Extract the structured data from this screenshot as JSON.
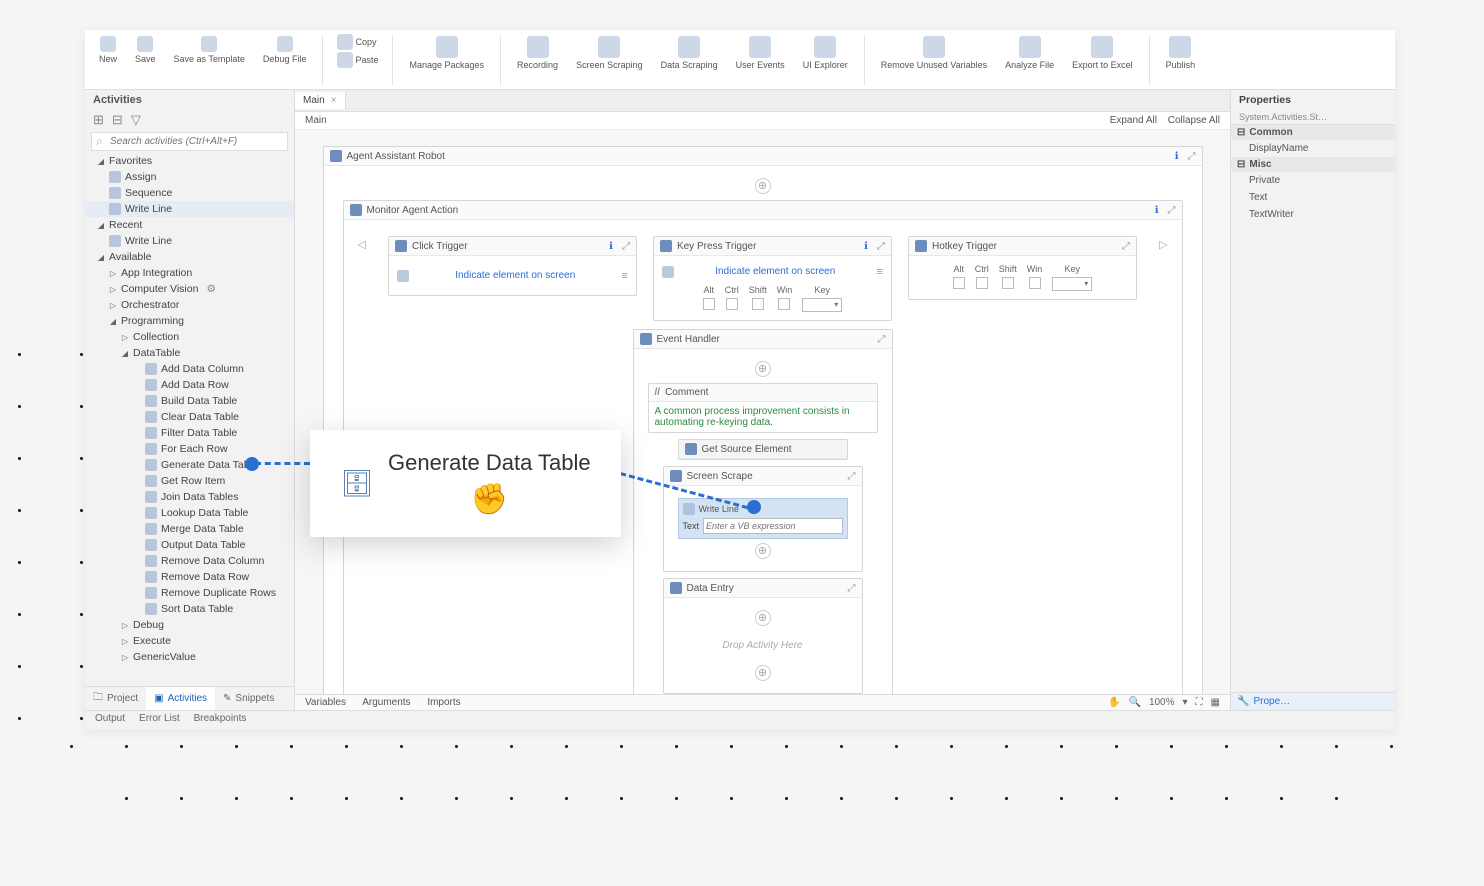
{
  "ribbon": {
    "items": [
      "New",
      "Save",
      "Save as Template",
      "Debug File",
      "Copy",
      "Paste",
      "Manage Packages",
      "Recording",
      "Screen Scraping",
      "Data Scraping",
      "User Events",
      "UI Explorer",
      "Remove Unused Variables",
      "Analyze File",
      "Export to Excel",
      "Publish"
    ]
  },
  "activities_panel": {
    "title": "Activities",
    "search_placeholder": "Search activities (Ctrl+Alt+F)",
    "favorites": "Favorites",
    "fav_items": [
      "Assign",
      "Sequence",
      "Write Line"
    ],
    "recent": "Recent",
    "recent_items": [
      "Write Line"
    ],
    "available": "Available",
    "available_groups": [
      "App Integration",
      "Computer Vision",
      "Orchestrator"
    ],
    "programming": "Programming",
    "prog_collection": "Collection",
    "prog_datatable": "DataTable",
    "dt_items": [
      "Add Data Column",
      "Add Data Row",
      "Build Data Table",
      "Clear Data Table",
      "Filter Data Table",
      "For Each Row",
      "Generate Data Table",
      "Get Row Item",
      "Join Data Tables",
      "Lookup Data Table",
      "Merge Data Table",
      "Output Data Table",
      "Remove Data Column",
      "Remove Data Row",
      "Remove Duplicate Rows",
      "Sort Data Table"
    ],
    "debug": "Debug",
    "execute": "Execute",
    "genericvalue": "GenericValue"
  },
  "bottom_tabs": {
    "project": "Project",
    "activities": "Activities",
    "snippets": "Snippets"
  },
  "tab": {
    "name": "Main",
    "close": "×"
  },
  "crumb": {
    "path": "Main",
    "expand": "Expand All",
    "collapse": "Collapse All"
  },
  "workflow": {
    "root": "Agent Assistant Robot",
    "monitor": "Monitor Agent Action",
    "click_trigger": "Click Trigger",
    "indicate": "Indicate element on screen",
    "keypress": "Key Press Trigger",
    "hotkey": "Hotkey Trigger",
    "mods": [
      "Alt",
      "Ctrl",
      "Shift",
      "Win"
    ],
    "key": "Key",
    "event_handler": "Event Handler",
    "comment_title": "Comment",
    "comment_text": "A common process improvement consists in automating re-keying data.",
    "get_source": "Get Source Element",
    "screen_scrape": "Screen Scrape",
    "write_line": "Write Line",
    "write_line_label": "Text",
    "write_line_ph": "Enter a VB expression",
    "data_entry": "Data Entry",
    "drop_hint": "Drop Activity Here"
  },
  "bottom_bar": {
    "variables": "Variables",
    "arguments": "Arguments",
    "imports": "Imports",
    "zoom": "100%"
  },
  "status_bar": {
    "output": "Output",
    "errors": "Error List",
    "breakpoints": "Breakpoints"
  },
  "properties": {
    "title": "Properties",
    "subtitle": "System.Activities.St…",
    "common": "Common",
    "common_items": [
      "DisplayName"
    ],
    "misc": "Misc",
    "misc_items": [
      "Private",
      "Text",
      "TextWriter"
    ],
    "tab": "Prope…"
  },
  "callout": {
    "label": "Generate Data Table"
  }
}
